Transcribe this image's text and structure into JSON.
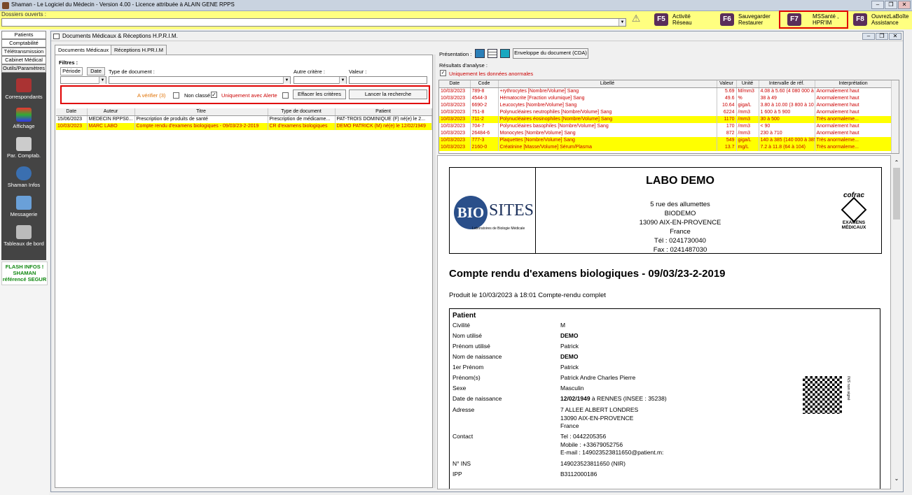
{
  "window": {
    "title": "Shaman - Le Logiciel du Médecin - Version 4.00 - Licence attribuée à ALAIN GENE RPPS"
  },
  "dossiers": {
    "label": "Dossiers ouverts :"
  },
  "fkeys": [
    {
      "key": "F5",
      "l1": "Activité",
      "l2": "Réseau"
    },
    {
      "key": "F6",
      "l1": "Sauvegarder",
      "l2": "Restaurer"
    },
    {
      "key": "F7",
      "l1": "MSSanté ,",
      "l2": "HPR'IM"
    },
    {
      "key": "F8",
      "l1": "OuvrezLaBoîte",
      "l2": "Assistance"
    }
  ],
  "leftnav": {
    "tabs": [
      "Patients",
      "Comptabilité",
      "Télétransmission",
      "Cabinet Médical",
      "Outils/Paramètres"
    ],
    "buttons": [
      "Correspondants",
      "Affichage",
      "Par. Comptab.",
      "Shaman Infos",
      "Messagerie",
      "Tableaux de bord"
    ],
    "flash": [
      "FLASH INFOS !",
      "SHAMAN",
      "référencé SEGUR"
    ]
  },
  "mdi": {
    "title": "Documents Médicaux & Réceptions H.P.R.I.M."
  },
  "tabs": {
    "docs": "Documents Médicaux",
    "hprim": "Réceptions H.PR.I.M"
  },
  "filters": {
    "title": "Filtres :",
    "periode": "Période",
    "date": "Date",
    "type_doc": "Type de document :",
    "autre": "Autre critère :",
    "valeur": "Valeur :",
    "a_verifier": "A vérifier (3)",
    "non_classe": "Non classé",
    "uniquement_alerte": "Uniquement avec Alerte",
    "effacer": "Effacer les critères",
    "lancer": "Lancer la recherche"
  },
  "doc_table": {
    "headers": [
      "Date",
      "Auteur",
      "Titre",
      "Type de document",
      "Patient"
    ],
    "rows": [
      [
        "15/06/2023",
        "MEDECIN RPPS0...",
        "Prescription de produits de santé",
        "Prescription de médicame...",
        "PAT-TROIS DOMINIQUE (F) né(e) le 2..."
      ],
      [
        "10/03/2023",
        "MARC LABO",
        "Compte rendu d'examens biologiques - 09/03/23-2-2019",
        "CR d'examens biologiques",
        "DEMO PATRICK (M) né(e) le 12/02/1949"
      ]
    ]
  },
  "presentation": {
    "label": "Présentation :",
    "envelope": "Enveloppe du document (CDA)"
  },
  "results": {
    "label": "Résultats d'analyse :",
    "only_abnormal": "Uniquement les données anormales",
    "headers": [
      "Date",
      "Code",
      "Libellé",
      "Valeur",
      "Unité",
      "Intervalle de réf.",
      "Interprétation"
    ],
    "rows": [
      [
        "10/03/2023",
        "789-8",
        "+rythrocytes [Nombre/Volume] Sang",
        "5.69",
        "M/mm3",
        "4.08 à 5.60 (4 080 000 à 5 ...",
        "Anormalement haut"
      ],
      [
        "10/03/2023",
        "4544-3",
        "Hématocrite [Fraction volumique] Sang",
        "49.6",
        "%",
        "38 à 49",
        "Anormalement haut"
      ],
      [
        "10/03/2023",
        "6690-2",
        "Leucocytes [Nombre/Volume] Sang",
        "10.64",
        "giga/L",
        "3.80 à 10.00 (3 800 à 10 000)",
        "Anormalement haut"
      ],
      [
        "10/03/2023",
        "751-8",
        "Polynucléaires neutrophiles [Nombre/Volume] Sang",
        "6224",
        "/mm3",
        "1 600 à 5 900",
        "Anormalement haut"
      ],
      [
        "10/03/2023",
        "711-2",
        "Polynucléaires éosinophiles [Nombre/Volume] Sang",
        "1170",
        "/mm3",
        "30 à 500",
        "Très anormaleme..."
      ],
      [
        "10/03/2023",
        "704-7",
        "Polynucléaires basophiles [Nombre/Volume] Sang",
        "170",
        "/mm3",
        "< 90",
        "Anormalement haut"
      ],
      [
        "10/03/2023",
        "26484-6",
        "Monocytes [Nombre/Volume] Sang",
        "872",
        "/mm3",
        "230 à 710",
        "Anormalement haut"
      ],
      [
        "10/03/2023",
        "777-3",
        "Plaquettes [Nombre/Volume] Sang",
        "549",
        "giga/L",
        "140 à 385 (140 000 à 385 ...",
        "Très anormaleme..."
      ],
      [
        "10/03/2023",
        "2160-0",
        "Créatinine [Masse/Volume] Sérum/Plasma",
        "13.7",
        "mg/L",
        "7.2 à 11.8 (64 à 104)",
        "Très anormaleme..."
      ]
    ],
    "yellow_rows": [
      4,
      7,
      8
    ]
  },
  "report": {
    "lab_name": "LABO DEMO",
    "addr": [
      "5 rue des allumettes",
      "BIODEMO",
      "13090 AIX-EN-PROVENCE",
      "France",
      "Tél : 0241730040",
      "Fax : 0241487030"
    ],
    "logo_bio": "BIO",
    "logo_sites": "SITES",
    "logo_sub": "Laboratoires de Biologie Médicale",
    "cofrac": "cofrac",
    "cofrac_sub": "EXAMENS MÉDICAUX",
    "title": "Compte rendu d'examens biologiques - 09/03/23-2-2019",
    "produced": "Produit le 10/03/2023 à 18:01 Compte-rendu complet",
    "patient_heading": "Patient",
    "fields": [
      {
        "k": "Civilité",
        "v": "M",
        "b": false
      },
      {
        "k": "Nom utilisé",
        "v": "DEMO",
        "b": true
      },
      {
        "k": "Prénom utilisé",
        "v": "Patrick",
        "b": false
      },
      {
        "k": "Nom de naissance",
        "v": "DEMO",
        "b": true
      },
      {
        "k": "1er Prénom",
        "v": "Patrick",
        "b": false
      },
      {
        "k": "Prénom(s)",
        "v": "Patrick Andre Charles Pierre",
        "b": false
      },
      {
        "k": "Sexe",
        "v": "Masculin",
        "b": false
      },
      {
        "k": "Date de naissance",
        "v": "12/02/1949",
        "v2": " à RENNES (INSEE : 35238)",
        "b": true
      }
    ],
    "adresse_label": "Adresse",
    "adresse": [
      "7 ALLEE ALBERT LONDRES",
      "13090 AIX-EN-PROVENCE",
      "France"
    ],
    "contact_label": "Contact",
    "contact": [
      "Tel : 0442205356",
      "Mobile : +33679052756",
      "E-mail : 149023523811650@patient.m:"
    ],
    "ins_label": "N° INS",
    "ins": "149023523811650 (NIR)",
    "ipp_label": "IPP",
    "ipp": "B3112000186",
    "ins_note": "INS non signé"
  }
}
